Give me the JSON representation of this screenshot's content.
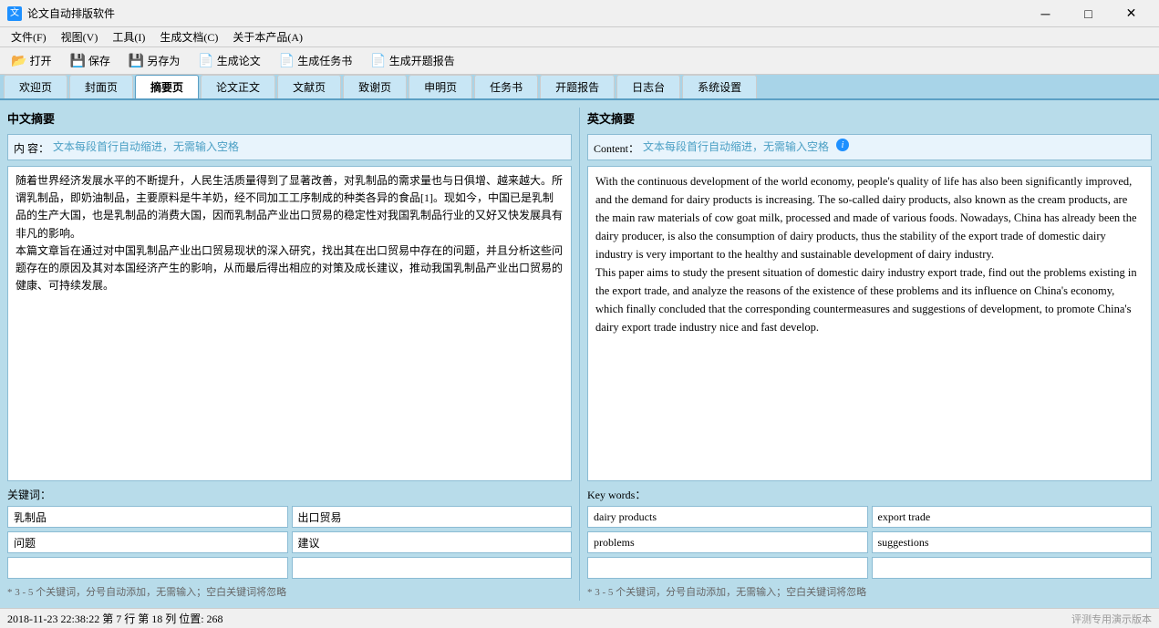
{
  "titleBar": {
    "appName": "论文自动排版软件",
    "minLabel": "─",
    "maxLabel": "□",
    "closeLabel": "✕"
  },
  "menuBar": {
    "items": [
      {
        "label": "文件(F)"
      },
      {
        "label": "视图(V)"
      },
      {
        "label": "工具(I)"
      },
      {
        "label": "生成文档(C)"
      },
      {
        "label": "关于本产品(A)"
      }
    ]
  },
  "toolbar": {
    "buttons": [
      {
        "icon": "📂",
        "label": "打开"
      },
      {
        "icon": "💾",
        "label": "保存"
      },
      {
        "icon": "💾",
        "label": "另存为"
      },
      {
        "icon": "📄",
        "label": "生成论文"
      },
      {
        "icon": "📄",
        "label": "生成任务书"
      },
      {
        "icon": "📄",
        "label": "生成开题报告"
      }
    ]
  },
  "tabs": {
    "items": [
      {
        "label": "欢迎页"
      },
      {
        "label": "封面页"
      },
      {
        "label": "摘要页",
        "active": true
      },
      {
        "label": "论文正文"
      },
      {
        "label": "文献页"
      },
      {
        "label": "致谢页"
      },
      {
        "label": "申明页"
      },
      {
        "label": "任务书"
      },
      {
        "label": "开题报告"
      },
      {
        "label": "日志台"
      },
      {
        "label": "系统设置"
      }
    ]
  },
  "leftPanel": {
    "sectionTitle": "中文摘要",
    "contentLabel": "内  容：",
    "contentHint": "文本每段首行自动缩进，无需输入空格",
    "mainText": "随着世界经济发展水平的不断提升，人民生活质量得到了显著改善，对乳制品的需求量也与日俱增、越来越大。所谓乳制品，即奶油制品，主要原料是牛羊奶，经不同加工工序制成的种类各异的食品[1]。现如今，中国已是乳制品的生产大国，也是乳制品的消费大国，因而乳制品产业出口贸易的稳定性对我国乳制品行业的又好又快发展具有非凡的影响。\n本篇文章旨在通过对中国乳制品产业出口贸易现状的深入研究，找出其在出口贸易中存在的问题，并且分析这些问题存在的原因及其对本国经济产生的影响，从而最后得出相应的对策及成长建议，推动我国乳制品产业出口贸易的健康、可持续发展。",
    "keywordsLabel": "关键词：",
    "keywords": [
      {
        "value": "乳制品",
        "placeholder": ""
      },
      {
        "value": "出口贸易",
        "placeholder": ""
      },
      {
        "value": "问题",
        "placeholder": ""
      },
      {
        "value": "建议",
        "placeholder": ""
      },
      {
        "value": "",
        "placeholder": ""
      },
      {
        "value": "",
        "placeholder": ""
      }
    ],
    "keywordsHint": "* 3 - 5 个关键词，分号自动添加，无需输入；空白关键词将忽略"
  },
  "rightPanel": {
    "sectionTitle": "英文摘要",
    "contentLabel": "Content：",
    "contentHint": "文本每段首行自动缩进，无需输入空格",
    "mainText": "With the continuous development of the world economy, people's quality of life has also been significantly improved, and the demand for dairy products is increasing. The so-called dairy products, also known as the cream products, are the main raw materials of cow goat milk, processed and made of various foods. Nowadays, China has already been the dairy producer, is also the consumption of dairy products, thus the stability of the export trade of domestic dairy industry is very important to the healthy and sustainable development of dairy industry.\nThis paper aims to study the present situation of domestic dairy industry export trade, find out the problems existing in the export trade, and analyze the reasons of the existence of these problems and its influence on China's economy, which finally concluded that the corresponding countermeasures and suggestions of development, to promote China's dairy export trade industry nice and fast develop.",
    "keywordsLabel": "Key words：",
    "keywords": [
      {
        "value": "dairy products",
        "placeholder": ""
      },
      {
        "value": "export trade",
        "placeholder": ""
      },
      {
        "value": "problems",
        "placeholder": ""
      },
      {
        "value": "suggestions",
        "placeholder": ""
      },
      {
        "value": "",
        "placeholder": ""
      },
      {
        "value": "",
        "placeholder": ""
      }
    ],
    "keywordsHint": "* 3 - 5 个关键词，分号自动添加，无需输入；空白关键词将忽略"
  },
  "statusBar": {
    "info": "2018-11-23  22:38:22   第 7 行 第 18 列  位置: 268",
    "watermark": "评测专用演示版本"
  }
}
